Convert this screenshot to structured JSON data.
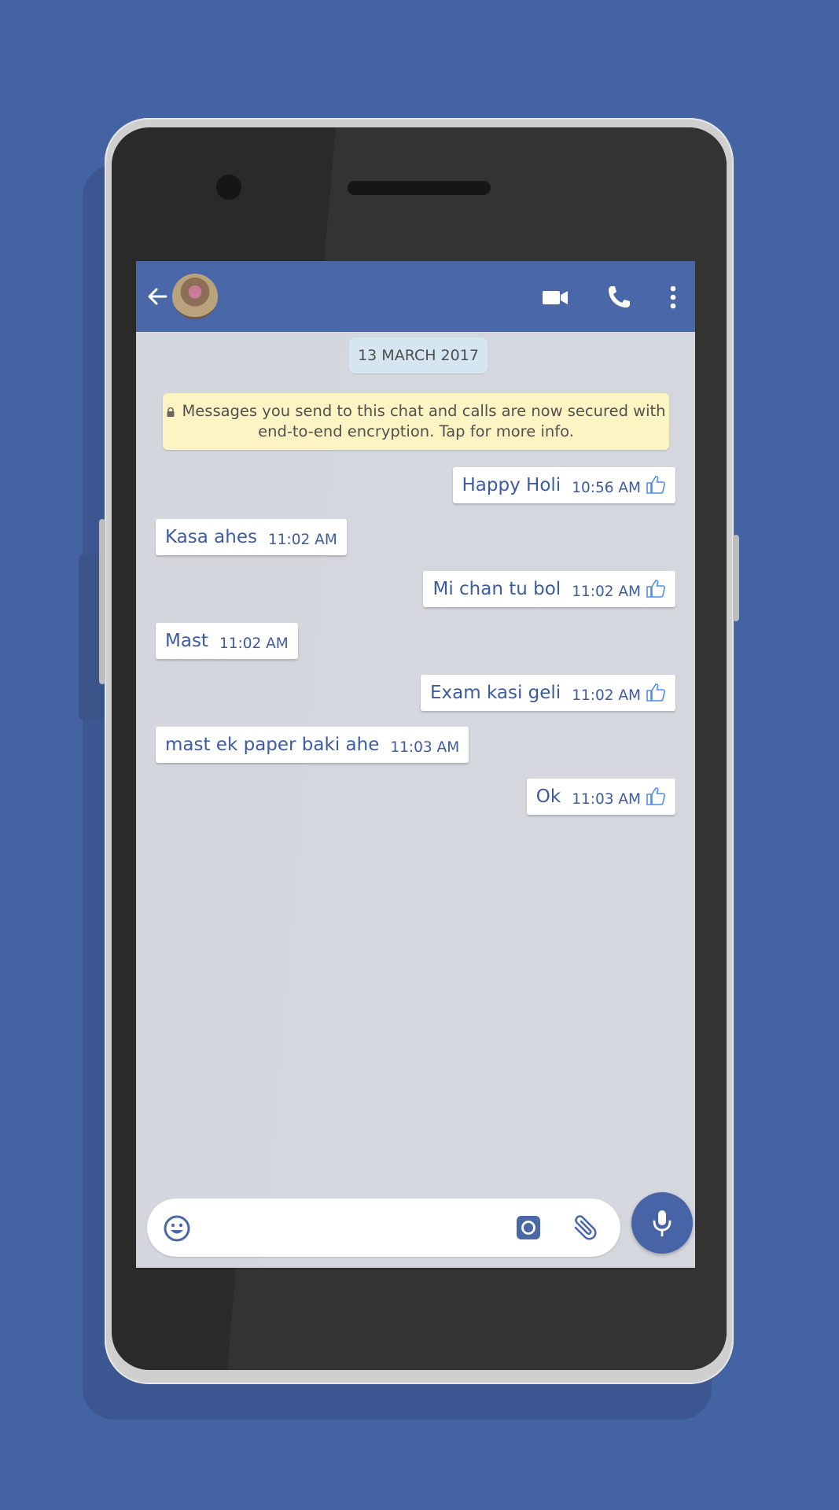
{
  "header": {
    "back_icon": "arrow-back-icon",
    "avatar": "contact-avatar",
    "actions": [
      "video-call-icon",
      "voice-call-icon",
      "more-vert-icon"
    ]
  },
  "chat": {
    "date_chip": "13 MARCH 2017",
    "encryption_notice_line1": "Messages you send to this chat and calls are now secured with",
    "encryption_notice_line2": "end-to-end encryption. Tap for more info.",
    "messages": [
      {
        "direction": "out",
        "text": "Happy Holi",
        "time": "10:56 AM",
        "status_icon": "thumbs-up-icon"
      },
      {
        "direction": "in",
        "text": "Kasa ahes",
        "time": "11:02 AM"
      },
      {
        "direction": "out",
        "text": "Mi chan tu bol",
        "time": "11:02 AM",
        "status_icon": "thumbs-up-icon"
      },
      {
        "direction": "in",
        "text": "Mast",
        "time": "11:02 AM"
      },
      {
        "direction": "out",
        "text": "Exam kasi geli",
        "time": "11:02 AM",
        "status_icon": "thumbs-up-icon"
      },
      {
        "direction": "in",
        "text": "mast ek paper baki ahe",
        "time": "11:03 AM"
      },
      {
        "direction": "out",
        "text": "Ok",
        "time": "11:03 AM",
        "status_icon": "thumbs-up-icon"
      }
    ]
  },
  "composer": {
    "placeholder": "",
    "value": "",
    "icons": [
      "emoji-icon",
      "camera-icon",
      "attach-icon",
      "mic-icon"
    ]
  },
  "colors": {
    "background": "#4463a2",
    "header": "#4a67a8",
    "chat_bg": "#d3d6dc",
    "message_text": "#3c5ba0",
    "encryption_banner": "#fdf4c4",
    "date_chip": "#d6e6f0"
  }
}
